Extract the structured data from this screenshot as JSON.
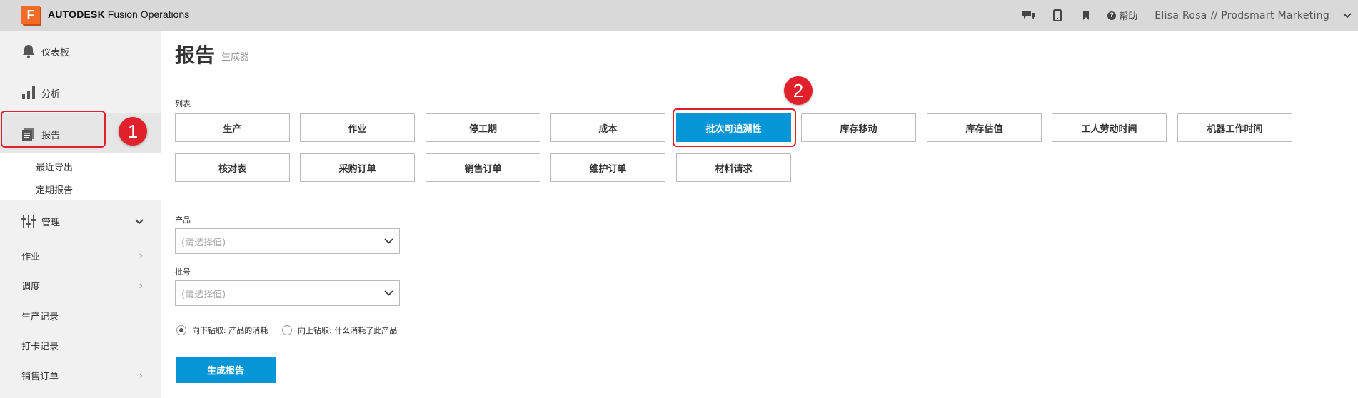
{
  "topbar": {
    "logo_letter": "F",
    "brand_bold": "AUTODESK",
    "brand_rest": " Fusion Operations",
    "help_label": "帮助",
    "help_glyph": "?",
    "user": "Elisa Rosa // Prodsmart Marketing",
    "icons": [
      "chat-icon",
      "mobile-icon",
      "bookmark-icon",
      "help-icon",
      "chevron-down-icon"
    ]
  },
  "sidebar": {
    "dashboard": "仪表板",
    "analytics": "分析",
    "reports": "报告",
    "recent_exports": "最近导出",
    "scheduled_reports": "定期报告",
    "management": "管理",
    "jobs": "作业",
    "scheduling": "调度",
    "production_records": "生产记录",
    "clock_records": "打卡记录",
    "sales_orders": "销售订单",
    "chevron": "›"
  },
  "annotations": {
    "one": "1",
    "two": "2"
  },
  "main": {
    "title": "报告",
    "subtitle": "生成器",
    "list_label": "列表",
    "report_types_row1": [
      "生产",
      "作业",
      "停工期",
      "成本",
      "批次可追溯性",
      "库存移动",
      "库存估值",
      "工人劳动时间",
      "机器工作时间"
    ],
    "report_types_row2": [
      "核对表",
      "采购订单",
      "销售订单",
      "维护订单",
      "材料请求"
    ],
    "active_report": "批次可追溯性",
    "product_label": "产品",
    "product_placeholder": "(请选择值)",
    "batch_label": "批号",
    "batch_placeholder": "(请选择值)",
    "radio_down": "向下钻取: 产品的消耗",
    "radio_up": "向上钻取: 什么消耗了此产品",
    "radio_selected": "down",
    "generate_button": "生成报告"
  },
  "colors": {
    "accent": "#0696d7",
    "annotation": "#e0202a",
    "logo": "#f26c28"
  }
}
